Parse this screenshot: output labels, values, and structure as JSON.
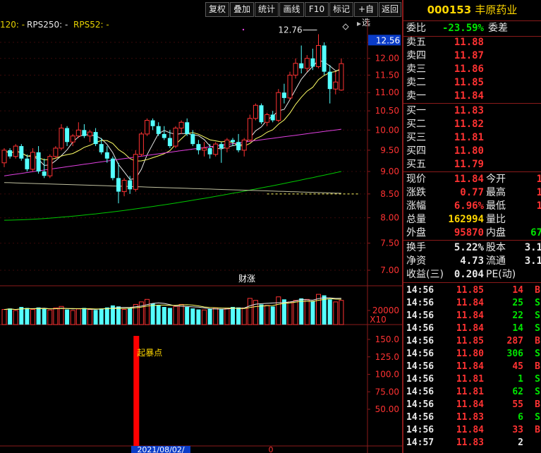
{
  "toolbar": {
    "buttons": [
      "复权",
      "叠加",
      "统计",
      "画线",
      "F10",
      "标记",
      "+自选",
      "返回"
    ]
  },
  "legend": {
    "ma_label": "120: -",
    "rps250": "RPS250: -",
    "rps52": "RPS52: -"
  },
  "price_axis": {
    "current_price": "12.56",
    "ticks": [
      "12.50",
      "12.00",
      "11.50",
      "11.00",
      "10.50",
      "10.00",
      "9.50",
      "9.00",
      "8.50",
      "8.00",
      "7.50",
      "7.00"
    ]
  },
  "annotations": {
    "high_marker": "12.76",
    "event_tag": "财涨",
    "signal_label": "起暴点",
    "date_label": "2021/08/02/",
    "bottom_mark": "0"
  },
  "volume_axis": {
    "tick": "20000",
    "unit": "X10"
  },
  "indicator_axis": {
    "ticks": [
      "150.0",
      "125.0",
      "100.0",
      "75.00",
      "50.00"
    ]
  },
  "stock": {
    "code": "000153",
    "name": "丰原药业"
  },
  "order_ratio": {
    "label": "委比",
    "value": "-23.59%",
    "diff_label": "委差"
  },
  "asks": [
    {
      "label": "卖五",
      "price": "11.88"
    },
    {
      "label": "卖四",
      "price": "11.87"
    },
    {
      "label": "卖三",
      "price": "11.86"
    },
    {
      "label": "卖二",
      "price": "11.85"
    },
    {
      "label": "卖一",
      "price": "11.84"
    }
  ],
  "bids": [
    {
      "label": "买一",
      "price": "11.83"
    },
    {
      "label": "买二",
      "price": "11.82"
    },
    {
      "label": "买三",
      "price": "11.81"
    },
    {
      "label": "买四",
      "price": "11.80"
    },
    {
      "label": "买五",
      "price": "11.79"
    }
  ],
  "quote": [
    {
      "l1": "现价",
      "v1": "11.84",
      "l2": "今开",
      "v2": "1"
    },
    {
      "l1": "涨跌",
      "v1": "0.77",
      "l2": "最高",
      "v2": "1"
    },
    {
      "l1": "涨幅",
      "v1": "6.96%",
      "l2": "最低",
      "v2": "1"
    },
    {
      "l1": "总量",
      "v1": "162994",
      "l2": "量比",
      "v2": ""
    },
    {
      "l1": "外盘",
      "v1": "95870",
      "l2": "内盘",
      "v2": "67"
    }
  ],
  "fundamentals": [
    {
      "l1": "换手",
      "v1": "5.22%",
      "l2": "股本",
      "v2": "3.1"
    },
    {
      "l1": "净资",
      "v1": "4.73",
      "l2": "流通",
      "v2": "3.1"
    },
    {
      "l1": "收益(三)",
      "v1": "0.204",
      "l2": "PE(动)",
      "v2": ""
    }
  ],
  "ticks": [
    {
      "time": "14:56",
      "price": "11.85",
      "vol": "14",
      "side": "B"
    },
    {
      "time": "14:56",
      "price": "11.84",
      "vol": "25",
      "side": "S"
    },
    {
      "time": "14:56",
      "price": "11.84",
      "vol": "22",
      "side": "S"
    },
    {
      "time": "14:56",
      "price": "11.84",
      "vol": "14",
      "side": "S"
    },
    {
      "time": "14:56",
      "price": "11.85",
      "vol": "287",
      "side": "B"
    },
    {
      "time": "14:56",
      "price": "11.80",
      "vol": "306",
      "side": "S"
    },
    {
      "time": "14:56",
      "price": "11.84",
      "vol": "45",
      "side": "B"
    },
    {
      "time": "14:56",
      "price": "11.81",
      "vol": "1",
      "side": "S"
    },
    {
      "time": "14:56",
      "price": "11.81",
      "vol": "62",
      "side": "S"
    },
    {
      "time": "14:56",
      "price": "11.84",
      "vol": "55",
      "side": "B"
    },
    {
      "time": "14:56",
      "price": "11.83",
      "vol": "6",
      "side": "S"
    },
    {
      "time": "14:56",
      "price": "11.84",
      "vol": "33",
      "side": "B"
    },
    {
      "time": "14:57",
      "price": "11.83",
      "vol": "2",
      "side": ""
    }
  ],
  "chart_data": {
    "type": "candlestick",
    "x_range": [
      0,
      60
    ],
    "price_ylim": [
      6.7,
      13.0
    ],
    "candles": [
      [
        9.2,
        9.55,
        9.1,
        9.5
      ],
      [
        9.5,
        9.55,
        9.3,
        9.35
      ],
      [
        9.35,
        9.65,
        9.3,
        9.6
      ],
      [
        9.6,
        9.65,
        9.25,
        9.3
      ],
      [
        9.3,
        9.4,
        9.0,
        9.05
      ],
      [
        9.05,
        9.55,
        9.0,
        9.45
      ],
      [
        9.45,
        9.6,
        8.95,
        9.0
      ],
      [
        9.0,
        9.3,
        8.85,
        8.9
      ],
      [
        8.9,
        9.4,
        8.85,
        9.35
      ],
      [
        9.35,
        9.6,
        9.3,
        9.55
      ],
      [
        9.55,
        10.15,
        9.5,
        10.05
      ],
      [
        10.05,
        10.1,
        9.6,
        9.7
      ],
      [
        9.7,
        9.9,
        9.6,
        9.85
      ],
      [
        9.85,
        10.2,
        9.8,
        10.0
      ],
      [
        10.0,
        10.15,
        9.8,
        9.85
      ],
      [
        9.85,
        10.0,
        9.7,
        9.95
      ],
      [
        9.95,
        10.05,
        9.6,
        9.65
      ],
      [
        9.65,
        9.8,
        9.4,
        9.45
      ],
      [
        9.45,
        9.6,
        9.2,
        9.3
      ],
      [
        9.3,
        9.35,
        8.8,
        8.85
      ],
      [
        8.85,
        9.2,
        8.3,
        8.55
      ],
      [
        8.55,
        8.85,
        8.45,
        8.8
      ],
      [
        8.8,
        8.9,
        8.5,
        8.6
      ],
      [
        8.6,
        9.5,
        8.55,
        9.4
      ],
      [
        9.4,
        9.95,
        9.35,
        9.9
      ],
      [
        9.9,
        10.3,
        9.85,
        10.25
      ],
      [
        10.25,
        10.3,
        10.0,
        10.1
      ],
      [
        10.1,
        10.2,
        9.85,
        9.9
      ],
      [
        9.9,
        10.1,
        9.75,
        9.8
      ],
      [
        9.8,
        10.0,
        9.55,
        9.6
      ],
      [
        9.6,
        10.1,
        9.55,
        10.05
      ],
      [
        10.05,
        10.25,
        9.9,
        10.2
      ],
      [
        10.2,
        10.3,
        9.85,
        9.9
      ],
      [
        9.9,
        10.0,
        9.6,
        9.65
      ],
      [
        9.65,
        9.75,
        9.4,
        9.5
      ],
      [
        9.5,
        9.7,
        9.35,
        9.55
      ],
      [
        9.55,
        9.65,
        9.3,
        9.4
      ],
      [
        9.4,
        9.7,
        9.35,
        9.65
      ],
      [
        9.65,
        9.7,
        9.2,
        9.55
      ],
      [
        9.55,
        9.8,
        9.45,
        9.75
      ],
      [
        9.75,
        9.8,
        9.6,
        9.7
      ],
      [
        9.7,
        9.9,
        9.45,
        9.5
      ],
      [
        9.5,
        9.8,
        9.35,
        9.75
      ],
      [
        9.75,
        10.4,
        9.7,
        10.3
      ],
      [
        10.3,
        10.7,
        10.25,
        10.65
      ],
      [
        10.65,
        10.7,
        10.15,
        10.2
      ],
      [
        10.2,
        10.45,
        10.1,
        10.4
      ],
      [
        10.4,
        10.5,
        10.2,
        10.25
      ],
      [
        10.25,
        11.1,
        10.2,
        11.0
      ],
      [
        11.0,
        11.25,
        10.7,
        10.85
      ],
      [
        10.85,
        11.6,
        10.8,
        11.5
      ],
      [
        11.5,
        12.0,
        11.4,
        11.85
      ],
      [
        11.85,
        12.4,
        11.55,
        11.7
      ],
      [
        11.7,
        12.1,
        11.6,
        12.0
      ],
      [
        12.0,
        12.3,
        11.65,
        11.75
      ],
      [
        11.75,
        12.76,
        11.7,
        12.4
      ],
      [
        12.4,
        12.5,
        11.5,
        11.6
      ],
      [
        11.6,
        11.8,
        10.7,
        11.1
      ],
      [
        11.1,
        11.6,
        10.95,
        11.3
      ],
      [
        11.07,
        12.0,
        11.05,
        11.84
      ]
    ],
    "volumes": [
      30,
      32,
      28,
      35,
      33,
      30,
      34,
      31,
      29,
      33,
      36,
      30,
      28,
      31,
      33,
      30,
      29,
      32,
      34,
      38,
      36,
      30,
      33,
      40,
      45,
      50,
      42,
      38,
      35,
      33,
      36,
      40,
      35,
      32,
      30,
      29,
      31,
      33,
      30,
      32,
      35,
      34,
      33,
      52,
      48,
      40,
      38,
      36,
      55,
      50,
      45,
      48,
      52,
      50,
      47,
      60,
      58,
      50,
      45,
      48
    ],
    "indicator": {
      "series": "signal",
      "index": 23,
      "value": 155
    }
  }
}
